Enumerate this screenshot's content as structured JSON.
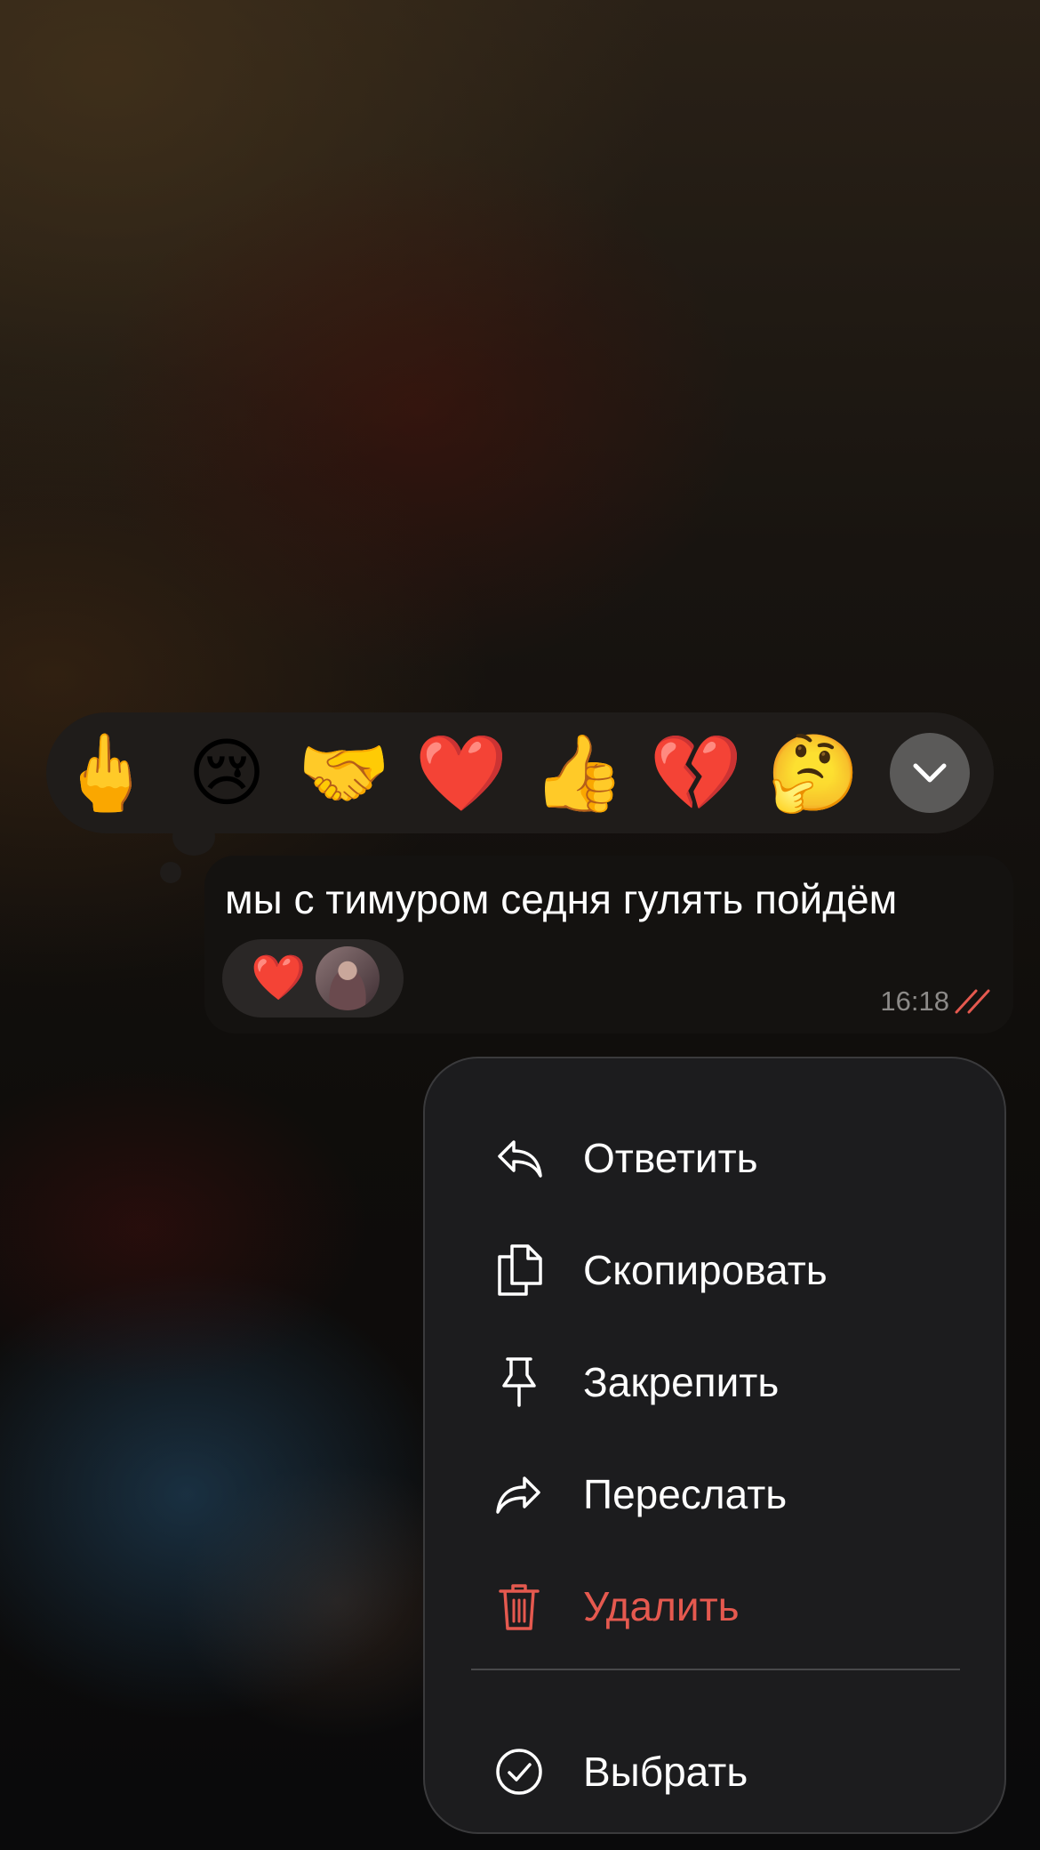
{
  "reactions": {
    "emojis": [
      "🖕",
      "😢",
      "🤝",
      "❤️",
      "👍",
      "💔",
      "🤔"
    ],
    "expand_icon": "chevron-down-icon"
  },
  "message": {
    "text": "мы с тимуром седня гулять пойдём",
    "reaction": {
      "emoji": "❤️"
    },
    "time": "16:18",
    "status_icon": "double-check-icon"
  },
  "menu": {
    "reply": "Ответить",
    "copy": "Скопировать",
    "pin": "Закрепить",
    "forward": "Переслать",
    "delete": "Удалить",
    "select": "Выбрать"
  },
  "colors": {
    "danger": "#e5594f",
    "read_check": "#e5594f",
    "menu_bg": "#1c1c1e"
  }
}
